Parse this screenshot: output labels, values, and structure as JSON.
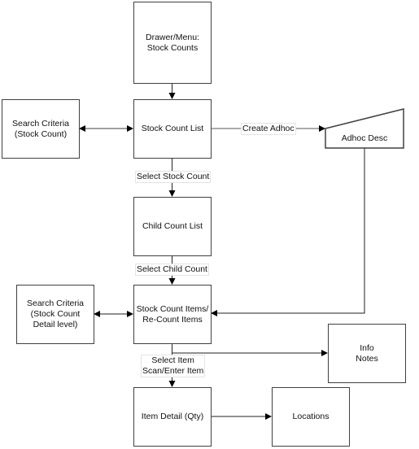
{
  "diagram": {
    "nodes": {
      "drawer_menu": "Drawer/Menu:\nStock Counts",
      "stock_count_list": "Stock Count List",
      "search_criteria_stock_count": "Search Criteria\n(Stock Count)",
      "adhoc_desc": "Adhoc Desc",
      "child_count_list": "Child Count List",
      "stock_count_items": "Stock Count Items/\nRe-Count Items",
      "search_criteria_detail": "Search Criteria\n(Stock Count\nDetail level)",
      "info_notes": "Info\nNotes",
      "item_detail": "Item Detail (Qty)",
      "locations": "Locations"
    },
    "edge_labels": {
      "create_adhoc": "Create Adhoc",
      "select_stock_count": "Select Stock Count",
      "select_child_count": "Select Child Count",
      "select_item": "Select Item\nScan/Enter Item"
    },
    "edges": [
      {
        "from": "drawer_menu",
        "to": "stock_count_list"
      },
      {
        "from": "search_criteria_stock_count",
        "to": "stock_count_list",
        "bidirectional": true
      },
      {
        "from": "stock_count_list",
        "to": "adhoc_desc",
        "label": "Create Adhoc"
      },
      {
        "from": "stock_count_list",
        "to": "child_count_list",
        "label": "Select Stock Count"
      },
      {
        "from": "child_count_list",
        "to": "stock_count_items",
        "label": "Select Child Count"
      },
      {
        "from": "adhoc_desc",
        "to": "stock_count_items"
      },
      {
        "from": "search_criteria_detail",
        "to": "stock_count_items",
        "bidirectional": true
      },
      {
        "from": "stock_count_items",
        "to": "info_notes"
      },
      {
        "from": "stock_count_items",
        "to": "item_detail",
        "label": "Select Item / Scan/Enter Item"
      },
      {
        "from": "item_detail",
        "to": "locations"
      }
    ]
  }
}
